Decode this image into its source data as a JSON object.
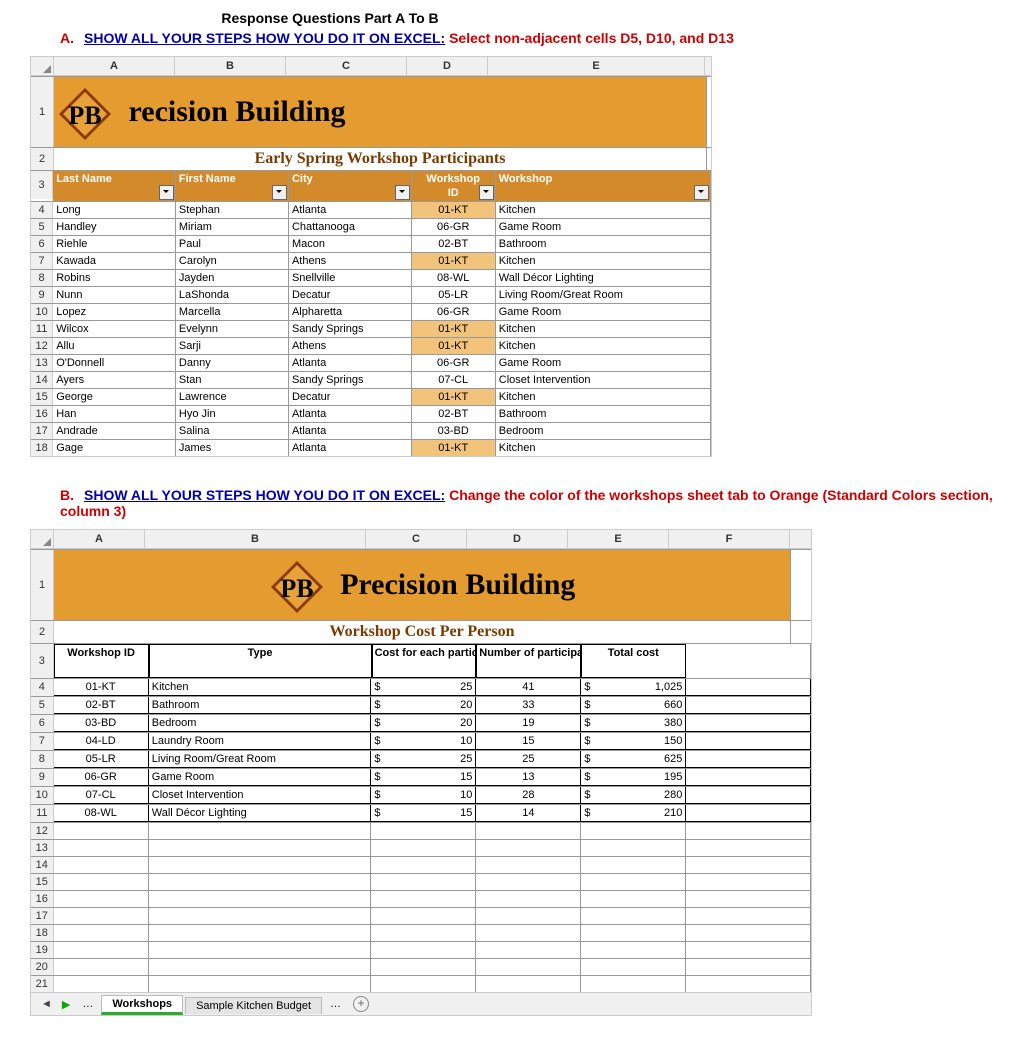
{
  "doc": {
    "main_title": "Response Questions Part A To B",
    "qA_letter": "A.",
    "qA_ul": "SHOW ALL YOUR STEPS HOW YOU DO IT ON EXCEL:",
    "qA_red": " Select non-adjacent cells D5, D10, and D13",
    "qB_letter": "B.",
    "qB_ul": "SHOW ALL YOUR STEPS HOW YOU DO IT ON EXCEL:",
    "qB_red": " Change the color of the workshops sheet tab to Orange (Standard Colors section, column 3)"
  },
  "sheetA": {
    "cols": [
      "A",
      "B",
      "C",
      "D",
      "E"
    ],
    "banner": "recision Building",
    "subtitle": "Early Spring Workshop Participants",
    "headers": {
      "last": "Last Name",
      "first": "First Name",
      "city": "City",
      "id_top": "Workshop",
      "id_bot": "ID",
      "ws": "Workshop"
    },
    "rows": [
      {
        "n": 4,
        "last": "Long",
        "first": "Stephan",
        "city": "Atlanta",
        "id": "01-KT",
        "ws": "Kitchen",
        "hl": true
      },
      {
        "n": 5,
        "last": "Handley",
        "first": "Miriam",
        "city": "Chattanooga",
        "id": "06-GR",
        "ws": "Game Room",
        "hl": false
      },
      {
        "n": 6,
        "last": "Riehle",
        "first": "Paul",
        "city": "Macon",
        "id": "02-BT",
        "ws": "Bathroom",
        "hl": false
      },
      {
        "n": 7,
        "last": "Kawada",
        "first": "Carolyn",
        "city": "Athens",
        "id": "01-KT",
        "ws": "Kitchen",
        "hl": true
      },
      {
        "n": 8,
        "last": "Robins",
        "first": "Jayden",
        "city": "Snellville",
        "id": "08-WL",
        "ws": "Wall Décor Lighting",
        "hl": false
      },
      {
        "n": 9,
        "last": "Nunn",
        "first": "LaShonda",
        "city": "Decatur",
        "id": "05-LR",
        "ws": "Living Room/Great Room",
        "hl": false
      },
      {
        "n": 10,
        "last": "Lopez",
        "first": "Marcella",
        "city": "Alpharetta",
        "id": "06-GR",
        "ws": "Game Room",
        "hl": false
      },
      {
        "n": 11,
        "last": "Wilcox",
        "first": "Evelynn",
        "city": "Sandy Springs",
        "id": "01-KT",
        "ws": "Kitchen",
        "hl": true
      },
      {
        "n": 12,
        "last": "Allu",
        "first": "Sarji",
        "city": "Athens",
        "id": "01-KT",
        "ws": "Kitchen",
        "hl": true
      },
      {
        "n": 13,
        "last": "O'Donnell",
        "first": "Danny",
        "city": "Atlanta",
        "id": "06-GR",
        "ws": "Game Room",
        "hl": false
      },
      {
        "n": 14,
        "last": "Ayers",
        "first": "Stan",
        "city": "Sandy Springs",
        "id": "07-CL",
        "ws": "Closet Intervention",
        "hl": false
      },
      {
        "n": 15,
        "last": "George",
        "first": "Lawrence",
        "city": "Decatur",
        "id": "01-KT",
        "ws": "Kitchen",
        "hl": true
      },
      {
        "n": 16,
        "last": "Han",
        "first": "Hyo Jin",
        "city": "Atlanta",
        "id": "02-BT",
        "ws": "Bathroom",
        "hl": false
      },
      {
        "n": 17,
        "last": "Andrade",
        "first": "Salina",
        "city": "Atlanta",
        "id": "03-BD",
        "ws": "Bedroom",
        "hl": false
      },
      {
        "n": 18,
        "last": "Gage",
        "first": "James",
        "city": "Atlanta",
        "id": "01-KT",
        "ws": "Kitchen",
        "hl": true
      }
    ]
  },
  "sheetB": {
    "cols": [
      "A",
      "B",
      "C",
      "D",
      "E",
      "F"
    ],
    "banner": "Precision Building",
    "subtitle": "Workshop Cost Per Person",
    "headers": {
      "id": "Workshop ID",
      "type": "Type",
      "cpp": "Cost for each participant",
      "num": "Number of participants",
      "tot": "Total cost"
    },
    "rows": [
      {
        "n": 4,
        "id": "01-KT",
        "type": "Kitchen",
        "cpp": "25",
        "num": "41",
        "tot": "1,025"
      },
      {
        "n": 5,
        "id": "02-BT",
        "type": "Bathroom",
        "cpp": "20",
        "num": "33",
        "tot": "660"
      },
      {
        "n": 6,
        "id": "03-BD",
        "type": "Bedroom",
        "cpp": "20",
        "num": "19",
        "tot": "380"
      },
      {
        "n": 7,
        "id": "04-LD",
        "type": "Laundry Room",
        "cpp": "10",
        "num": "15",
        "tot": "150"
      },
      {
        "n": 8,
        "id": "05-LR",
        "type": "Living Room/Great Room",
        "cpp": "25",
        "num": "25",
        "tot": "625"
      },
      {
        "n": 9,
        "id": "06-GR",
        "type": "Game Room",
        "cpp": "15",
        "num": "13",
        "tot": "195"
      },
      {
        "n": 10,
        "id": "07-CL",
        "type": "Closet Intervention",
        "cpp": "10",
        "num": "28",
        "tot": "280"
      },
      {
        "n": 11,
        "id": "08-WL",
        "type": "Wall Décor Lighting",
        "cpp": "15",
        "num": "14",
        "tot": "210"
      }
    ],
    "empty_rows": [
      12,
      13,
      14,
      15,
      16,
      17,
      18,
      19,
      20,
      21
    ],
    "tabs": {
      "active": "Workshops",
      "other": "Sample Kitchen Budget"
    }
  },
  "chart_data": {
    "type": "table",
    "title": "Workshop Cost Per Person",
    "columns": [
      "Workshop ID",
      "Type",
      "Cost for each participant",
      "Number of participants",
      "Total cost"
    ],
    "rows": [
      [
        "01-KT",
        "Kitchen",
        25,
        41,
        1025
      ],
      [
        "02-BT",
        "Bathroom",
        20,
        33,
        660
      ],
      [
        "03-BD",
        "Bedroom",
        20,
        19,
        380
      ],
      [
        "04-LD",
        "Laundry Room",
        10,
        15,
        150
      ],
      [
        "05-LR",
        "Living Room/Great Room",
        25,
        25,
        625
      ],
      [
        "06-GR",
        "Game Room",
        15,
        13,
        195
      ],
      [
        "07-CL",
        "Closet Intervention",
        10,
        28,
        280
      ],
      [
        "08-WL",
        "Wall Décor Lighting",
        15,
        14,
        210
      ]
    ]
  }
}
